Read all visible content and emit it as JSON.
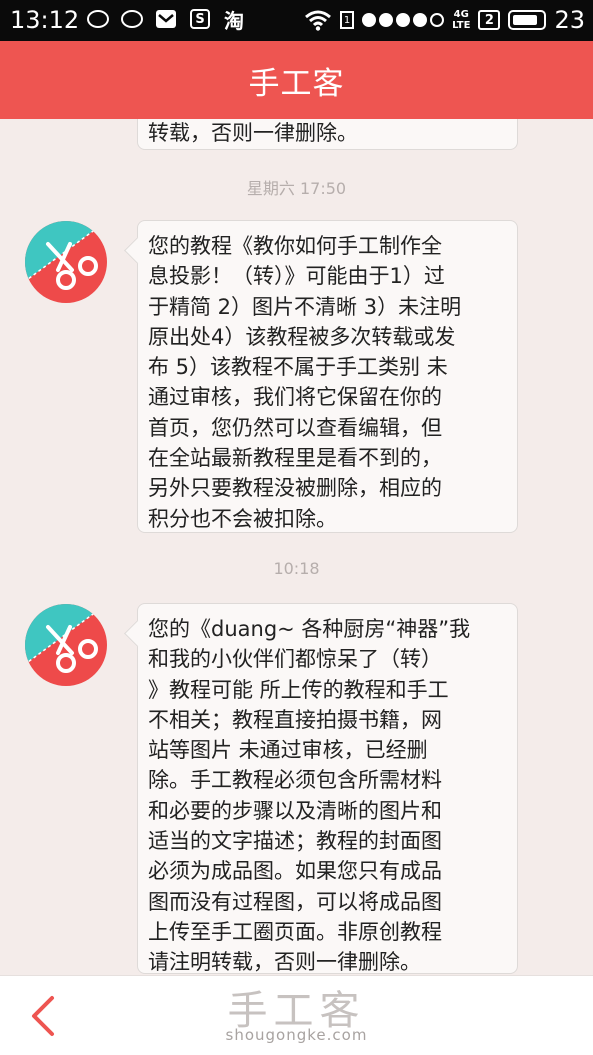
{
  "status_bar": {
    "time": "13:12",
    "taobao_label": "淘",
    "s_label": "S",
    "network": [
      "4G",
      "LTE"
    ],
    "sim_label": "2",
    "battery_level": "23"
  },
  "header": {
    "title": "手工客"
  },
  "messages": [
    {
      "lines": [
        "转载，否则一律删除。"
      ]
    },
    {
      "timestamp": "星期六 17:50",
      "lines": [
        "您的教程《教你如何手工制作全",
        "息投影！（转）》可能由于1）过",
        "于精简 2）图片不清晰 3）未注明",
        "原出处4）该教程被多次转载或发",
        "布 5）该教程不属于手工类别 未",
        "通过审核，我们将它保留在你的",
        "首页，您仍然可以查看编辑，但",
        "在全站最新教程里是看不到的，",
        "另外只要教程没被删除，相应的",
        "积分也不会被扣除。"
      ]
    },
    {
      "timestamp": "10:18",
      "lines": [
        "您的《duang~ 各种厨房“神器”我",
        "和我的小伙伴们都惊呆了（转）",
        "》教程可能 所上传的教程和手工",
        "不相关；教程直接拍摄书籍，网",
        "站等图片 未通过审核，已经删",
        "除。手工教程必须包含所需材料",
        "和必要的步骤以及清晰的图片和",
        "适当的文字描述；教程的封面图",
        "必须为成品图。如果您只有成品",
        "图而没有过程图，可以将成品图",
        "上传至手工圈页面。非原创教程",
        "请注明转载，否则一律删除。"
      ]
    }
  ],
  "watermark": {
    "title": "手工客",
    "url": "shougongke.com"
  },
  "colors": {
    "brand": "#ee5551",
    "avatar_teal": "#3fc6c1",
    "avatar_red": "#ee4a4a"
  },
  "icons": [
    "chat-bubble-icon",
    "message-icon",
    "mail-icon",
    "s-app-icon",
    "taobao-icon",
    "wifi-icon",
    "sim-icon",
    "signal-icon",
    "battery-icon",
    "scissors-avatar-icon",
    "back-chevron-icon"
  ]
}
